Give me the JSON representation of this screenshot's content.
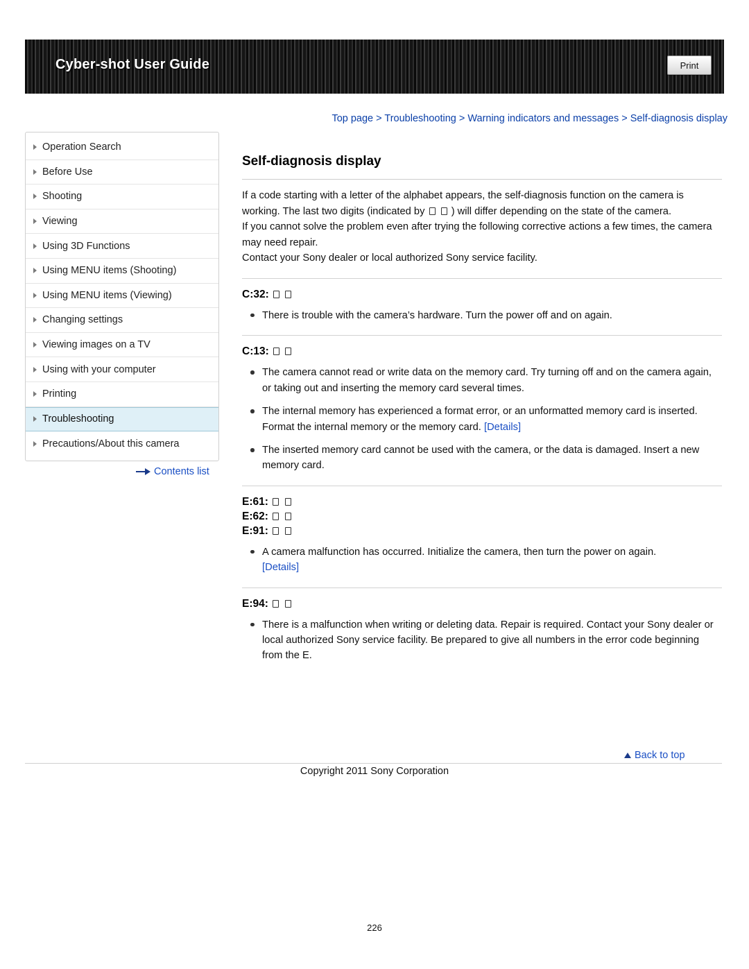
{
  "header": {
    "title": "Cyber-shot User Guide",
    "print_label": "Print"
  },
  "breadcrumb": {
    "items": [
      "Top page",
      "Troubleshooting",
      "Warning indicators and messages",
      "Self-diagnosis display"
    ],
    "separator": ">",
    "text": "Top page > Troubleshooting > Warning indicators and messages > Self-diagnosis display"
  },
  "sidebar": {
    "items": [
      {
        "label": "Operation Search",
        "active": false
      },
      {
        "label": "Before Use",
        "active": false
      },
      {
        "label": "Shooting",
        "active": false
      },
      {
        "label": "Viewing",
        "active": false
      },
      {
        "label": "Using 3D Functions",
        "active": false
      },
      {
        "label": "Using MENU items (Shooting)",
        "active": false
      },
      {
        "label": "Using MENU items (Viewing)",
        "active": false
      },
      {
        "label": "Changing settings",
        "active": false
      },
      {
        "label": "Viewing images on a TV",
        "active": false
      },
      {
        "label": "Using with your computer",
        "active": false
      },
      {
        "label": "Printing",
        "active": false
      },
      {
        "label": "Troubleshooting",
        "active": true
      },
      {
        "label": "Precautions/About this camera",
        "active": false
      }
    ],
    "contents_list_label": "Contents list"
  },
  "main": {
    "title": "Self-diagnosis display",
    "intro_p1_a": "If a code starting with a letter of the alphabet appears, the self-diagnosis function on the camera is working. The last two digits (indicated by",
    "intro_p1_b": ") will differ depending on the state of the camera.",
    "intro_p2": "If you cannot solve the problem even after trying the following corrective actions a few times, the camera may need repair.",
    "intro_p3": "Contact your Sony dealer or local authorized Sony service facility.",
    "sections": [
      {
        "codes": [
          "C:32:"
        ],
        "bullets": [
          {
            "text": "There is trouble with the camera’s hardware. Turn the power off and on again.",
            "link": ""
          }
        ]
      },
      {
        "codes": [
          "C:13:"
        ],
        "bullets": [
          {
            "text": "The camera cannot read or write data on the memory card. Try turning off and on the camera again, or taking out and inserting the memory card several times.",
            "link": ""
          },
          {
            "text": "The internal memory has experienced a format error, or an unformatted memory card is inserted. Format the internal memory or the memory card.",
            "link": "[Details]"
          },
          {
            "text": "The inserted memory card cannot be used with the camera, or the data is damaged. Insert a new memory card.",
            "link": ""
          }
        ]
      },
      {
        "codes": [
          "E:61:",
          "E:62:",
          "E:91:"
        ],
        "bullets": [
          {
            "text": "A camera malfunction has occurred. Initialize the camera, then turn the power on again.",
            "link": "[Details]"
          }
        ]
      },
      {
        "codes": [
          "E:94:"
        ],
        "bullets": [
          {
            "text": "There is a malfunction when writing or deleting data. Repair is required. Contact your Sony dealer or local authorized Sony service facility. Be prepared to give all numbers in the error code beginning from the E.",
            "link": ""
          }
        ]
      }
    ]
  },
  "footer": {
    "back_to_top": "Back to top",
    "copyright": "Copyright 2011 Sony Corporation",
    "page_number": "226"
  },
  "colors": {
    "link": "#1a4fc4",
    "active_bg": "#dff0f7",
    "header_bg": "#1c1c1c"
  }
}
